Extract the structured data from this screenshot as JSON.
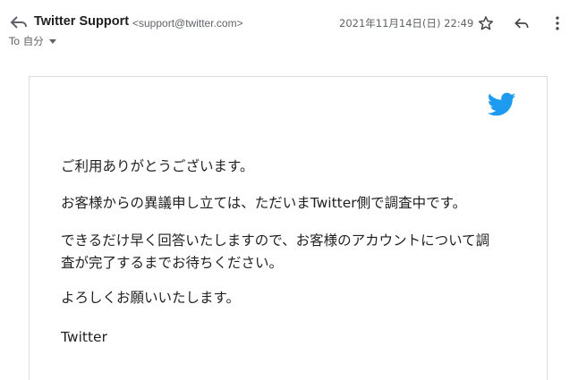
{
  "header": {
    "sender_name": "Twitter Support",
    "sender_email": "<support@twitter.com>",
    "to_label": "To 自分",
    "date": "2021年11月14日(日) 22:49",
    "icons": {
      "back": "reply-arrow-icon",
      "star": "star-icon",
      "reply": "reply-icon",
      "more": "more-vert-icon"
    }
  },
  "email": {
    "logo": "twitter-bird-icon",
    "brand_color": "#1d9bf0",
    "lines": [
      "ご利用ありがとうございます。",
      "お客様からの異議申し立ては、ただいまTwitter側で調査中です。",
      "できるだけ早く回答いたしますので、お客様のアカウントについて調",
      "査が完了するまでお待ちください。",
      "よろしくお願いいたします。",
      "Twitter"
    ]
  }
}
